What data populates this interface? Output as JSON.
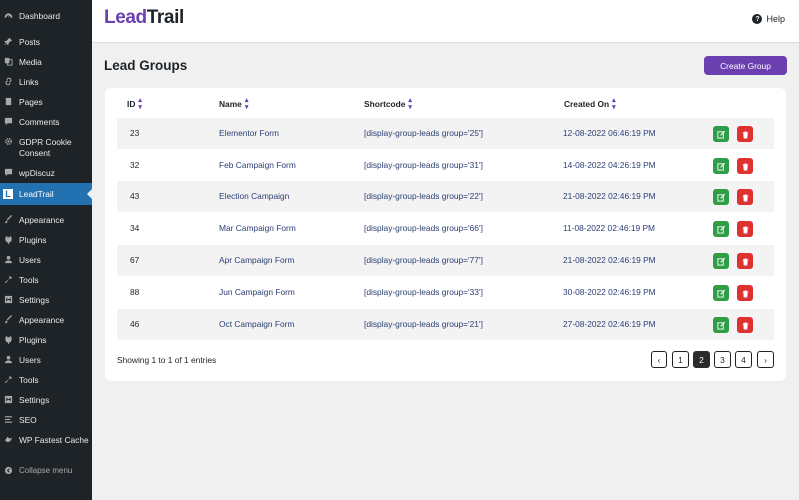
{
  "sidebar": {
    "items": [
      {
        "label": "Dashboard",
        "icon": "dashboard-icon"
      },
      {
        "label": "Posts",
        "icon": "pin-icon"
      },
      {
        "label": "Media",
        "icon": "media-icon"
      },
      {
        "label": "Links",
        "icon": "link-icon"
      },
      {
        "label": "Pages",
        "icon": "pages-icon"
      },
      {
        "label": "Comments",
        "icon": "comment-icon"
      },
      {
        "label": "GDPR Cookie Consent",
        "icon": "gear-icon"
      },
      {
        "label": "wpDiscuz",
        "icon": "comment-icon"
      },
      {
        "label": "LeadTrail",
        "icon": "leadtrail-logo-icon"
      },
      {
        "label": "Appearance",
        "icon": "brush-icon"
      },
      {
        "label": "Plugins",
        "icon": "plugin-icon"
      },
      {
        "label": "Users",
        "icon": "user-icon"
      },
      {
        "label": "Tools",
        "icon": "wrench-icon"
      },
      {
        "label": "Settings",
        "icon": "settings-icon"
      },
      {
        "label": "Appearance",
        "icon": "brush-icon"
      },
      {
        "label": "Plugins",
        "icon": "plugin-icon"
      },
      {
        "label": "Users",
        "icon": "user-icon"
      },
      {
        "label": "Tools",
        "icon": "wrench-icon"
      },
      {
        "label": "Settings",
        "icon": "settings-icon"
      },
      {
        "label": "SEO",
        "icon": "seo-icon"
      },
      {
        "label": "WP Fastest Cache",
        "icon": "cheetah-icon"
      },
      {
        "label": "Collapse menu",
        "icon": "collapse-icon"
      }
    ]
  },
  "header": {
    "brand_part1": "Lead",
    "brand_part2": "Trail",
    "help_label": "Help"
  },
  "main": {
    "title": "Lead Groups",
    "create_button": "Create Group",
    "table": {
      "columns": [
        "ID",
        "Name",
        "Shortcode",
        "Created On"
      ],
      "rows": [
        {
          "id": "23",
          "name": "Elementor Form",
          "shortcode": "[display-group-leads group='25']",
          "created": "12-08-2022 06:46:19 PM"
        },
        {
          "id": "32",
          "name": "Feb Campaign Form",
          "shortcode": "[display-group-leads group='31']",
          "created": "14-08-2022 04:26:19 PM"
        },
        {
          "id": "43",
          "name": "Election Campaign",
          "shortcode": "[display-group-leads group='22']",
          "created": "21-08-2022 02:46:19 PM"
        },
        {
          "id": "34",
          "name": "Mar Campaign Form",
          "shortcode": "[display-group-leads group='66']",
          "created": "11-08-2022 02:46:19 PM"
        },
        {
          "id": "67",
          "name": "Apr Campaign Form",
          "shortcode": "[display-group-leads group='77']",
          "created": "21-08-2022 02:46:19 PM"
        },
        {
          "id": "88",
          "name": "Jun Campaign Form",
          "shortcode": "[display-group-leads group='33']",
          "created": "30-08-2022 02:46:19 PM"
        },
        {
          "id": "46",
          "name": "Oct Campaign Form",
          "shortcode": "[display-group-leads group='21']",
          "created": "27-08-2022 02:46:19 PM"
        }
      ]
    },
    "footer_info": "Showing 1 to 1 of 1 entries",
    "pagination": {
      "prev": "‹",
      "pages": [
        "1",
        "2",
        "3",
        "4"
      ],
      "active_page": "2",
      "next": "›"
    }
  },
  "colors": {
    "accent": "#6c3fb0",
    "sidebar_bg": "#1d2327",
    "active_menu": "#2271b1",
    "edit": "#2e9e48",
    "delete": "#e03131"
  }
}
